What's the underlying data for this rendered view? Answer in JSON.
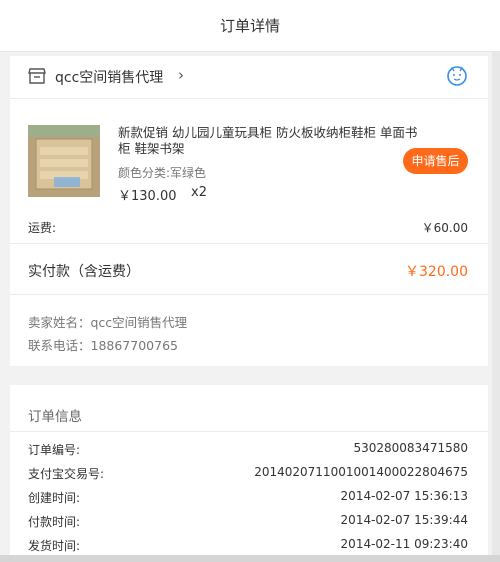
{
  "header": {
    "title": "订单详情"
  },
  "shop": {
    "icon": "store-icon",
    "name": "qcc空间销售代理",
    "chevron": "›",
    "service_icon": "customer-service-icon"
  },
  "product": {
    "title": "新款促销 幼儿园儿童玩具柜 防火板收纳柜鞋柜 单面书柜 鞋架书架",
    "spec": "颜色分类:军绿色",
    "price": "￥130.00",
    "quantity": "x2",
    "after_sale_label": "申请售后",
    "image_icon": "product-thumbnail"
  },
  "fees": {
    "shipping_label": "运费:",
    "shipping_value": "￥60.00",
    "paid_label": "实付款（含运费）",
    "paid_value": "￥320.00"
  },
  "seller": {
    "name": "卖家姓名：qcc空间销售代理",
    "phone": "联系电话：18867700765"
  },
  "order_info": {
    "title": "订单信息",
    "rows": [
      {
        "k": "订单编号:",
        "v": "530280083471580"
      },
      {
        "k": "支付宝交易号:",
        "v": "2014020711001001400022804675"
      },
      {
        "k": "创建时间:",
        "v": "2014-02-07 15:36:13"
      },
      {
        "k": "付款时间:",
        "v": "2014-02-07 15:39:44"
      },
      {
        "k": "发货时间:",
        "v": "2014-02-11 09:23:40"
      }
    ]
  },
  "colors": {
    "accent": "#ff6a1a",
    "icon_blue": "#3a8ee6"
  }
}
